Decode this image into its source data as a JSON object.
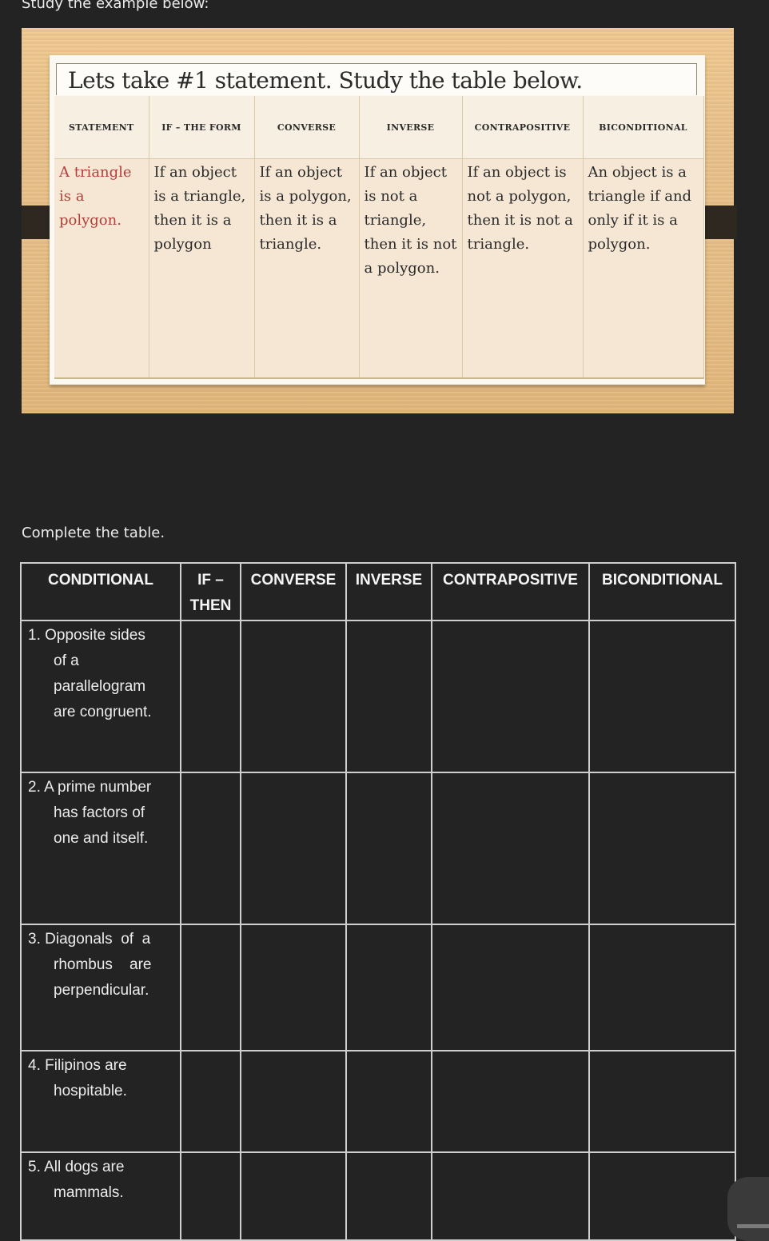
{
  "intro_text": "Study the example below:",
  "example": {
    "title": "Lets take #1 statement. Study the table below.",
    "headers": [
      "STATEMENT",
      "IF – THE FORM",
      "CONVERSE",
      "INVERSE",
      "CONTRAPOSITIVE",
      "BICONDITIONAL"
    ],
    "row": [
      "A triangle is a polygon.",
      "If an object is a triangle, then it is a polygon",
      "If an object is a polygon, then it is a triangle.",
      "If an object is not a triangle, then it is not a polygon.",
      "If an object is not a polygon, then it is not a triangle.",
      "An object is a triangle if and only if it is a polygon."
    ]
  },
  "instruction": "Complete the table.",
  "worksheet": {
    "headers": [
      "CONDITIONAL",
      "IF – THEN",
      "CONVERSE",
      "INVERSE",
      "CONTRAPOSITIVE",
      "BICONDITIONAL"
    ],
    "rows": [
      {
        "num": "1.",
        "lines": [
          "Opposite sides",
          "of a",
          "parallelogram",
          "are congruent."
        ]
      },
      {
        "num": "2.",
        "lines": [
          "A prime number",
          "has factors of",
          "one and itself."
        ]
      },
      {
        "num": "3.",
        "lines": [
          "Diagonals  of  a",
          "rhombus    are",
          "perpendicular."
        ]
      },
      {
        "num": "4.",
        "lines": [
          "Filipinos are",
          "hospitable."
        ]
      },
      {
        "num": "5.",
        "lines": [
          "All dogs are",
          "mammals."
        ]
      }
    ]
  }
}
